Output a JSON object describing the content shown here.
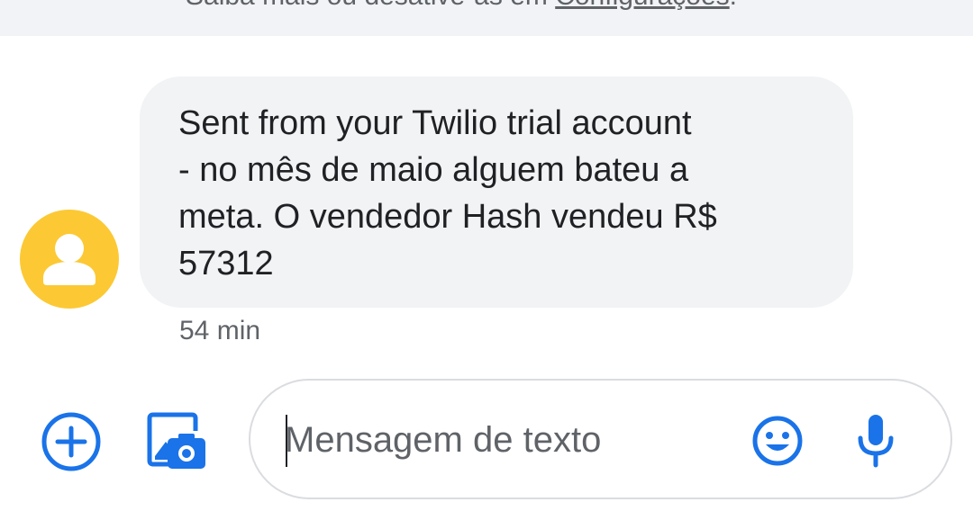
{
  "banner": {
    "text_prefix": "Saiba mais ou desative-as em ",
    "link_label": "Configurações",
    "text_suffix": "."
  },
  "message": {
    "text": "Sent from your Twilio trial account\n- no mês de maio alguem bateu a\nmeta. O vendedor Hash vendeu R$\n57312",
    "timestamp": "54 min",
    "avatar_icon": "person-icon",
    "avatar_color": "#fcc934"
  },
  "composer": {
    "placeholder": "Mensagem de texto",
    "value": "",
    "accent_color": "#1a73e8",
    "icons": {
      "add": "add-circle-icon",
      "gallery": "gallery-camera-icon",
      "emoji": "emoji-icon",
      "mic": "microphone-icon"
    }
  }
}
